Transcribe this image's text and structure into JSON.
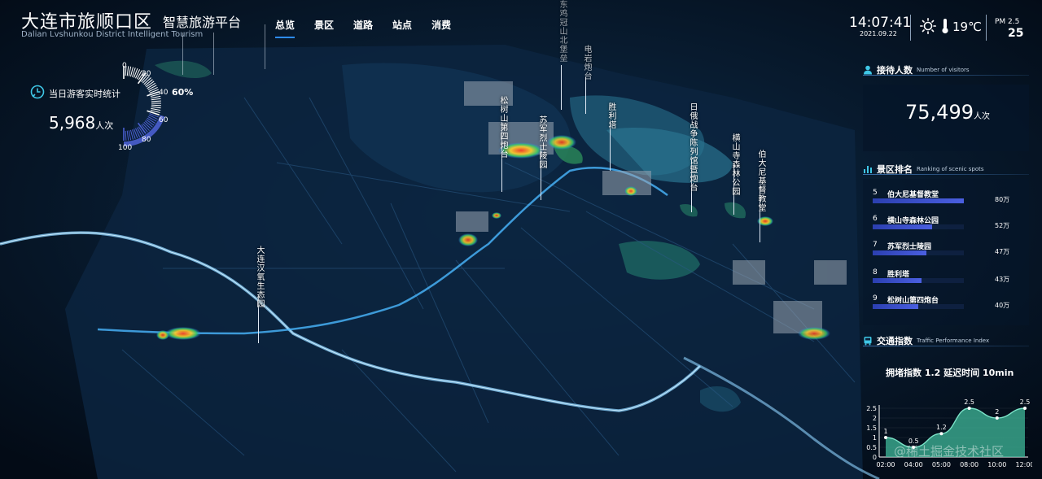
{
  "header": {
    "title": "大连市旅顺口区",
    "subtitle": "智慧旅游平台",
    "title_en": "Dalian Lvshunkou District Intelligent Tourism",
    "tabs": [
      {
        "label": "总览",
        "active": true
      },
      {
        "label": "景区",
        "active": false
      },
      {
        "label": "道路",
        "active": false
      },
      {
        "label": "站点",
        "active": false
      },
      {
        "label": "消费",
        "active": false
      }
    ],
    "time": "14:07:41",
    "date": "2021.09.22",
    "temperature": "19℃",
    "pm_label": "PM 2.5",
    "pm_value": "25",
    "weather_icon": "sun-icon",
    "temp_icon": "thermometer-icon"
  },
  "realtime": {
    "label": "当日游客实时统计",
    "value": "5,968",
    "unit": "人次",
    "percent_text": "60%",
    "percent": 60,
    "ticks": [
      "0",
      "20",
      "40",
      "60",
      "80",
      "100"
    ],
    "icon": "clock-chart-icon"
  },
  "map": {
    "spots": [
      {
        "label": "松树山第四炮台"
      },
      {
        "label": "苏军烈士陵园"
      },
      {
        "label": "胜利塔"
      },
      {
        "label": "日俄战争陈列馆暨炮台"
      },
      {
        "label": "横山寺森林公园"
      },
      {
        "label": "伯大尼基督教堂"
      },
      {
        "label": "大连汉氧生态园"
      },
      {
        "label": "东鸡冠山北堡垒"
      },
      {
        "label": "电岩炮台"
      }
    ]
  },
  "visitors": {
    "title": "接待人数",
    "title_en": "Number of visitors",
    "value": "75,499",
    "unit": "人次",
    "icon": "person-icon"
  },
  "ranking": {
    "title": "景区排名",
    "title_en": "Ranking of scenic spots",
    "icon": "bar-chart-icon",
    "items": [
      {
        "no": "5",
        "name": "伯大尼基督教堂",
        "value": "80万",
        "amount": 80
      },
      {
        "no": "6",
        "name": "横山寺森林公园",
        "value": "52万",
        "amount": 52
      },
      {
        "no": "7",
        "name": "苏军烈士陵园",
        "value": "47万",
        "amount": 47
      },
      {
        "no": "8",
        "name": "胜利塔",
        "value": "43万",
        "amount": 43
      },
      {
        "no": "9",
        "name": "松树山第四炮台",
        "value": "40万",
        "amount": 40
      }
    ]
  },
  "traffic": {
    "title": "交通指数",
    "title_en": "Traffic Performance Index",
    "icon": "bus-icon",
    "summary": "拥堵指数 1.2   延迟时间 10min"
  },
  "chart_data": {
    "type": "area",
    "x": [
      "02:00",
      "04:00",
      "05:00",
      "08:00",
      "10:00",
      "12:00"
    ],
    "x_positions": [
      0,
      1,
      2,
      3,
      4,
      5
    ],
    "points": [
      {
        "x": 0,
        "y": 1
      },
      {
        "x": 1,
        "y": 0.5
      },
      {
        "x": 2,
        "y": 1.2
      },
      {
        "x": 3,
        "y": 2.5
      },
      {
        "x": 4,
        "y": 2
      },
      {
        "x": 5,
        "y": 2.5
      }
    ],
    "yticks": [
      "0",
      "0.5",
      "1",
      "1.5",
      "2",
      "2.5"
    ],
    "ylim": [
      0,
      2.5
    ],
    "color": "#3fb89a"
  },
  "watermark": "@稀土掘金技术社区"
}
